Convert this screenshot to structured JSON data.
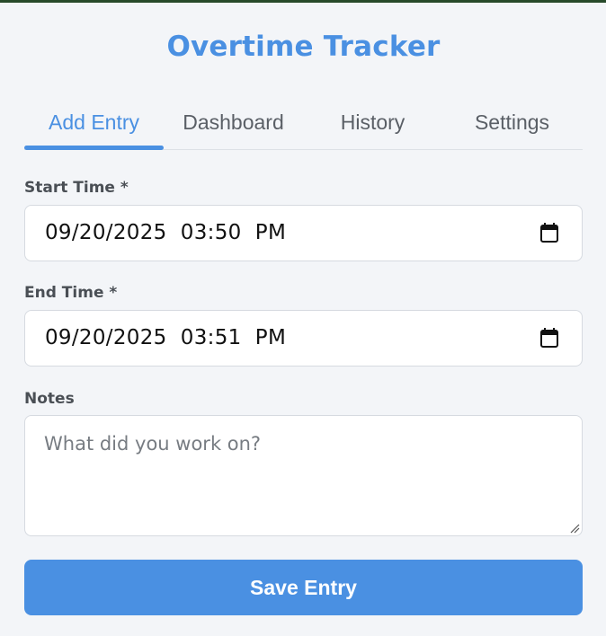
{
  "app": {
    "title": "Overtime Tracker",
    "accent_color": "#4a90e2"
  },
  "tabs": [
    {
      "label": "Add Entry",
      "active": true
    },
    {
      "label": "Dashboard",
      "active": false
    },
    {
      "label": "History",
      "active": false
    },
    {
      "label": "Settings",
      "active": false
    }
  ],
  "form": {
    "start_time": {
      "label": "Start Time *",
      "value": "09/20/2025  03:50  PM",
      "icon": "calendar-icon"
    },
    "end_time": {
      "label": "End Time *",
      "value": "09/20/2025  03:51  PM",
      "icon": "calendar-icon"
    },
    "notes": {
      "label": "Notes",
      "value": "",
      "placeholder": "What did you work on?"
    },
    "save_label": "Save Entry"
  }
}
